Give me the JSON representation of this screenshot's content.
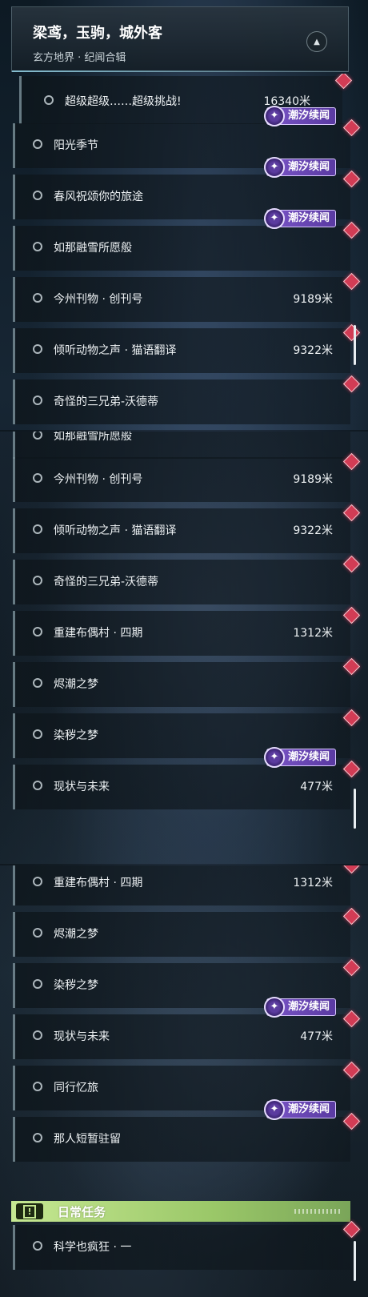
{
  "header": {
    "title": "梁鸢，玉驹，城外客",
    "subtitle": "玄方地界 · 纪闻合辑",
    "collapse_icon": "chevron-up-icon"
  },
  "tag_label": "潮汐续闻",
  "daily": {
    "label": "日常任务"
  },
  "panel1": [
    {
      "name": "超级超级……超级挑战!",
      "distance": "16340米"
    },
    {
      "name": "阳光季节",
      "distance": "",
      "tag": true
    },
    {
      "name": "春风祝颂你的旅途",
      "distance": "",
      "tag": true
    },
    {
      "name": "如那融雪所愿般",
      "distance": "",
      "tag": true
    },
    {
      "name": "今州刊物 · 创刊号",
      "distance": "9189米"
    },
    {
      "name": "倾听动物之声 · 猫语翻译",
      "distance": "9322米"
    },
    {
      "name": "奇怪的三兄弟-沃德蒂",
      "distance": ""
    }
  ],
  "panel2": [
    {
      "name": "如那融雪所愿般",
      "distance": ""
    },
    {
      "name": "今州刊物 · 创刊号",
      "distance": "9189米"
    },
    {
      "name": "倾听动物之声 · 猫语翻译",
      "distance": "9322米"
    },
    {
      "name": "奇怪的三兄弟-沃德蒂",
      "distance": ""
    },
    {
      "name": "重建布偶村 · 四期",
      "distance": "1312米"
    },
    {
      "name": "烬潮之梦",
      "distance": ""
    },
    {
      "name": "染秽之梦",
      "distance": ""
    },
    {
      "name": "现状与未来",
      "distance": "477米",
      "tag": true
    }
  ],
  "panel3": [
    {
      "name": "重建布偶村 · 四期",
      "distance": "1312米"
    },
    {
      "name": "烬潮之梦",
      "distance": ""
    },
    {
      "name": "染秽之梦",
      "distance": ""
    },
    {
      "name": "现状与未来",
      "distance": "477米",
      "tag": true
    },
    {
      "name": "同行忆旅",
      "distance": ""
    },
    {
      "name": "那人短暂驻留",
      "distance": "",
      "tag": true
    }
  ],
  "daily_quests": [
    {
      "name": "科学也疯狂 · 一",
      "distance": ""
    }
  ]
}
